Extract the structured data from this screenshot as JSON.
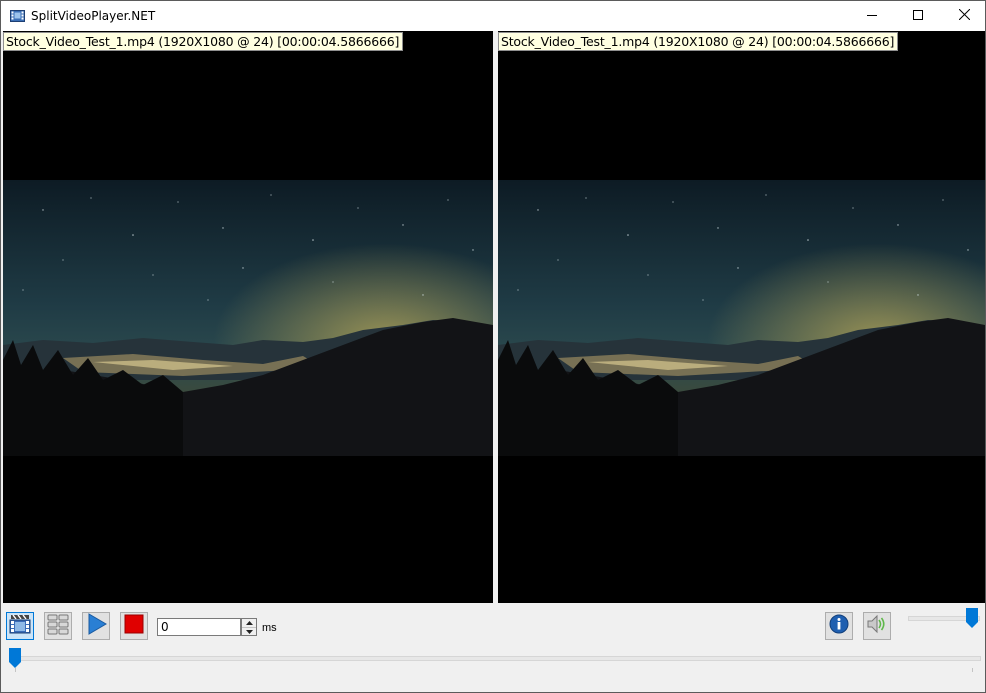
{
  "window": {
    "title": "SplitVideoPlayer.NET"
  },
  "icons": {
    "app": "film-icon",
    "minimize": "minimize-icon",
    "maximize": "maximize-icon",
    "close": "close-icon",
    "single_view": "clapper-icon",
    "grid_view": "grid-icon",
    "play": "play-icon",
    "stop": "stop-icon",
    "info": "info-icon",
    "volume": "speaker-icon"
  },
  "left_video": {
    "label": "Stock_Video_Test_1.mp4 (1920X1080 @ 24) [00:00:04.5866666]"
  },
  "right_video": {
    "label": "Stock_Video_Test_1.mp4 (1920X1080 @ 24) [00:00:04.5866666]"
  },
  "controls": {
    "offset_value": "0",
    "offset_unit": "ms",
    "volume_level": 1.0,
    "seek_position": 0.0
  },
  "colors": {
    "accent": "#0078d7",
    "stop_red": "#e00000",
    "play_blue": "#2a7fd4",
    "label_bg": "#ffffe1"
  }
}
